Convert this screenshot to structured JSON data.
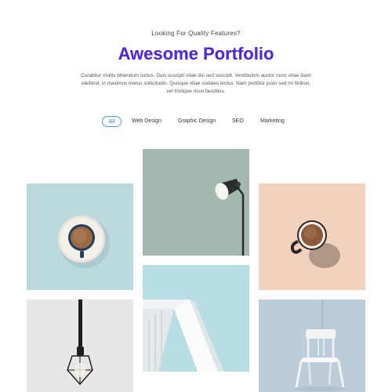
{
  "header": {
    "eyebrow": "Looking For Quality Features?",
    "title": "Awesome Portfolio",
    "description": "Curabitur mollis bibendum luctus. Duis suscipit vitae dui sed suscipit. Vestibulum auctor nunc vitae diam eleifend, in maximus metus sollicitudin. Quisque vitae sodales lectus. Nam porttitor justo sed mi finibus, vel tristique risus faucibus."
  },
  "filters": [
    {
      "label": "All",
      "active": true
    },
    {
      "label": "Web Design",
      "active": false
    },
    {
      "label": "Graphic Design",
      "active": false
    },
    {
      "label": "SEO",
      "active": false
    },
    {
      "label": "Marketing",
      "active": false
    }
  ],
  "portfolio": {
    "items": [
      {
        "subject": "coffee-cup-top-view",
        "background": "#bcd9dc"
      },
      {
        "subject": "desk-lamp",
        "background": "#9fb5ac"
      },
      {
        "subject": "coffee-cup-side",
        "background": "#f0d2bd"
      },
      {
        "subject": "pendant-bulb",
        "background": "#ececec"
      },
      {
        "subject": "architecture",
        "background": "#b5dde3"
      },
      {
        "subject": "white-chair",
        "background": "#bccdda"
      }
    ]
  },
  "colors": {
    "title_gradient_start": "#4b1fd6",
    "title_gradient_end": "#7a3df0",
    "active_filter": "#4aa3d8"
  }
}
